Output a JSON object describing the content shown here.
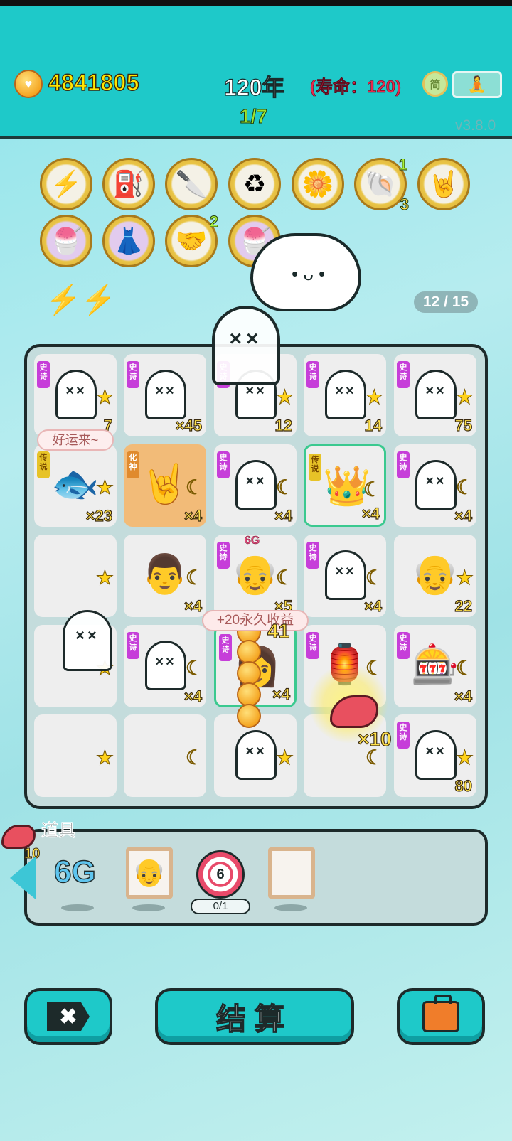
{
  "header": {
    "coins": "4841805",
    "year": "120年",
    "lifespan": "(寿命：120)",
    "round": "1/7",
    "version": "v3.8.0",
    "simplified_label": "简"
  },
  "relics": [
    {
      "icon": "⚡",
      "name": "lightning-relic-icon",
      "badge": ""
    },
    {
      "icon": "⛽",
      "name": "air-pump-relic-icon",
      "badge": ""
    },
    {
      "icon": "🔪",
      "name": "cleaver-relic-icon",
      "badge": ""
    },
    {
      "icon": "♻",
      "name": "recycle-relic-icon",
      "badge": ""
    },
    {
      "icon": "🌼",
      "name": "flower-pot-relic-icon",
      "badge": ""
    },
    {
      "icon": "🐚",
      "name": "shell-relic-icon",
      "badge": "1",
      "badge2": "3"
    },
    {
      "icon": "🤘",
      "name": "rock-hand-relic-icon",
      "badge": ""
    },
    {
      "icon": "🍧",
      "name": "bowls-relic-icon",
      "badge": ""
    },
    {
      "icon": "👗",
      "name": "skirt-relic-icon",
      "badge": ""
    },
    {
      "icon": "🤝",
      "name": "handshake-relic-icon",
      "badge": "2"
    },
    {
      "icon": "🍧",
      "name": "bowls-relic-2-icon",
      "badge": ""
    }
  ],
  "slots_counter": "12 / 15",
  "speech_bubble": "好运来~",
  "income_popup": "+20永久收益",
  "income_value": "41",
  "board_popup_count": "×10",
  "tag_text": {
    "epic": "史诗",
    "legendary": "传说",
    "god": "化神"
  },
  "cells": [
    {
      "tag": "epic",
      "icon": "ghost",
      "mark": "star",
      "count": "7"
    },
    {
      "tag": "epic",
      "icon": "ghost",
      "mark": "",
      "count": "×45"
    },
    {
      "tag": "epic",
      "icon": "ghost",
      "mark": "star",
      "count": "12"
    },
    {
      "tag": "epic",
      "icon": "ghost",
      "mark": "star",
      "count": "14"
    },
    {
      "tag": "epic",
      "icon": "ghost",
      "mark": "star",
      "count": "75"
    },
    {
      "tag": "legendary",
      "icon": "🐟",
      "mark": "star",
      "count": "×23"
    },
    {
      "tag": "god",
      "icon": "🤘",
      "mark": "moon",
      "count": "×4",
      "style": "orange"
    },
    {
      "tag": "epic",
      "icon": "ghost",
      "mark": "moon",
      "count": "×4"
    },
    {
      "tag": "legendary",
      "icon": "👑",
      "mark": "moon",
      "count": "×4",
      "style": "legend"
    },
    {
      "tag": "epic",
      "icon": "ghost",
      "mark": "moon",
      "count": "×4"
    },
    {
      "tag": "",
      "icon": "",
      "mark": "star",
      "count": ""
    },
    {
      "tag": "",
      "icon": "👨",
      "mark": "moon",
      "count": "×4"
    },
    {
      "tag": "epic",
      "icon": "👴",
      "mark": "moon",
      "count": "×5"
    },
    {
      "tag": "epic",
      "icon": "ghost",
      "mark": "moon",
      "count": "×4"
    },
    {
      "tag": "",
      "icon": "👴",
      "mark": "star",
      "count": "22"
    },
    {
      "tag": "",
      "icon": "",
      "mark": "star",
      "count": ""
    },
    {
      "tag": "epic",
      "icon": "ghost",
      "mark": "moon",
      "count": "×4"
    },
    {
      "tag": "epic",
      "icon": "👩",
      "mark": "",
      "count": "×4",
      "style": "legend"
    },
    {
      "tag": "epic",
      "icon": "🏮",
      "mark": "moon",
      "count": ""
    },
    {
      "tag": "epic",
      "icon": "🎰",
      "mark": "moon",
      "count": "×4"
    },
    {
      "tag": "",
      "icon": "",
      "mark": "star",
      "count": ""
    },
    {
      "tag": "",
      "icon": "",
      "mark": "moon",
      "count": ""
    },
    {
      "tag": "",
      "icon": "ghost",
      "mark": "star",
      "count": ""
    },
    {
      "tag": "",
      "icon": "",
      "mark": "moon",
      "count": ""
    },
    {
      "tag": "epic",
      "icon": "ghost",
      "mark": "star",
      "count": "80"
    }
  ],
  "cell_6g_label": "6G",
  "tools": {
    "title": "道具",
    "liver_count": "10",
    "six_g": "6G",
    "target_value": "6",
    "target_progress": "0/1"
  },
  "buttons": {
    "quit": "✖",
    "settle": "结算"
  },
  "colors": {
    "topbar": "#1ec9c9",
    "accent_yellow": "#ffe14a",
    "life_red": "#e8274b",
    "epic_tag": "#c63ed9",
    "legendary_tag": "#e7c327"
  }
}
